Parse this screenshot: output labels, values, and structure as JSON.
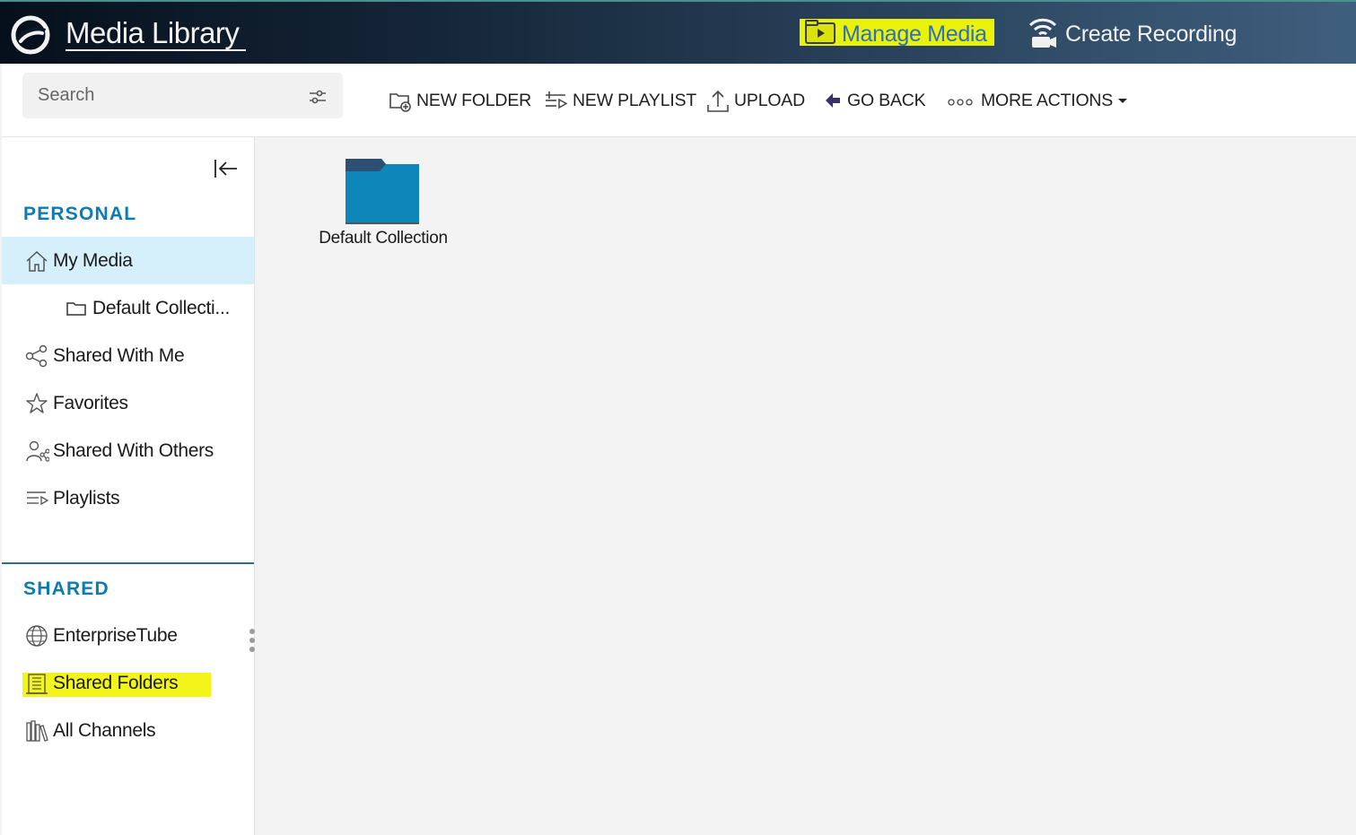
{
  "header": {
    "app_title": "Media Library",
    "manage_media_label": "Manage Media",
    "create_recording_label": "Create Recording",
    "highlight_color": "#e9f20a"
  },
  "toolbar": {
    "search_placeholder": "Search",
    "new_folder_label": "NEW FOLDER",
    "new_playlist_label": "NEW PLAYLIST",
    "upload_label": "UPLOAD",
    "go_back_label": "GO BACK",
    "more_actions_label": "MORE ACTIONS"
  },
  "sidebar": {
    "personal_title": "PERSONAL",
    "personal_items": [
      {
        "label": "My Media",
        "icon": "home-icon",
        "active": true
      },
      {
        "label": "Default Collecti...",
        "icon": "folder-icon"
      },
      {
        "label": "Shared With Me",
        "icon": "share-icon"
      },
      {
        "label": "Favorites",
        "icon": "star-icon"
      },
      {
        "label": "Shared With Others",
        "icon": "user-share-icon"
      },
      {
        "label": "Playlists",
        "icon": "playlist-icon"
      }
    ],
    "shared_title": "SHARED",
    "shared_items": [
      {
        "label": "EnterpriseTube",
        "icon": "globe-icon"
      },
      {
        "label": "Shared Folders",
        "icon": "building-icon",
        "highlighted": true
      },
      {
        "label": "All Channels",
        "icon": "library-icon"
      }
    ],
    "accent_color": "#0c7bb3",
    "active_bg": "#d6f0fb"
  },
  "main": {
    "folders": [
      {
        "label": "Default Collection",
        "color": "#0e86b9"
      }
    ]
  }
}
